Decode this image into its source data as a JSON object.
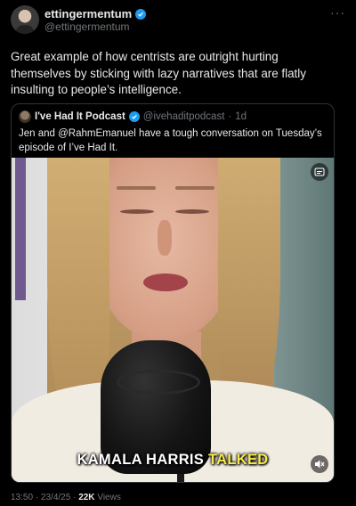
{
  "header": {
    "display_name": "ettingermentum",
    "handle": "@ettingermentum",
    "more": "···"
  },
  "tweet": {
    "text": "Great example of how centrists are outright hurting themselves by sticking with lazy narratives that are flatly insulting to people’s intelligence."
  },
  "quote": {
    "display_name": "I've Had It Podcast",
    "handle": "@ivehaditpodcast",
    "separator": "·",
    "age": "1d",
    "text": "Jen and @RahmEmanuel have a tough conversation on Tuesday’s episode of I’ve Had It.",
    "media": {
      "caption_white": "KAMALA HARRIS ",
      "caption_highlight": "TALKED"
    }
  },
  "footer": {
    "time": "13:50",
    "dot1": " · ",
    "date": "23/4/25",
    "dot2": " · ",
    "views_count": "22K",
    "views_label": " Views"
  },
  "colors": {
    "background": "#000000",
    "verified": "#1d9bf0",
    "caption_highlight": "#f7e94a",
    "secondary_text": "#71767b"
  }
}
